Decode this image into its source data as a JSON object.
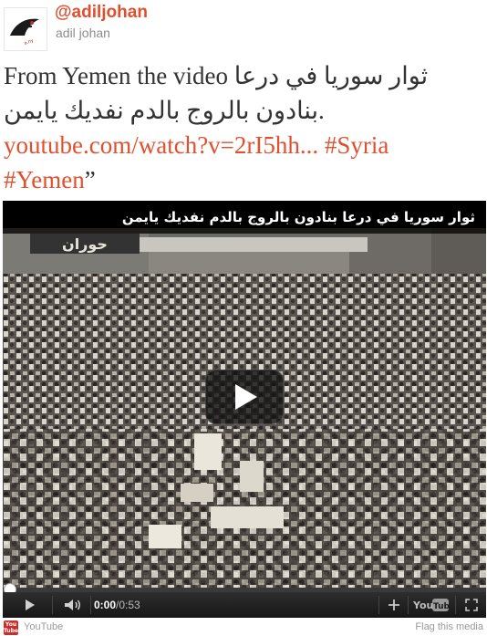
{
  "user": {
    "handle": "@adiljohan",
    "display_name": "adil johan"
  },
  "tweet": {
    "text_plain": "From Yemen the video ثوار سوريا في درعا بنادون بالروج بالدم نفديك يايمن.",
    "link": "youtube.com/watch?v=2rI5hh...",
    "hashtag1": "#Syria",
    "hashtag2": "#Yemen",
    "closing_quote": "”"
  },
  "video": {
    "title": "ثوار سوريا في درعا بنادون بالروج بالدم نفديك يايمن",
    "banner_text": "حوران",
    "current_time": "0:00",
    "separator": " / ",
    "duration": "0:53",
    "progress": 0.0
  },
  "controls": {
    "play": "play-icon",
    "volume": "volume-icon",
    "add": "add-icon",
    "youtube_logo_text": "You Tube",
    "fullscreen": "fullscreen-icon"
  },
  "footer": {
    "source_logo_text": "You Tube",
    "source_name": "YouTube",
    "flag_label": "Flag this media"
  },
  "colors": {
    "accent": "#e0502f",
    "progress": "#c0282c"
  }
}
